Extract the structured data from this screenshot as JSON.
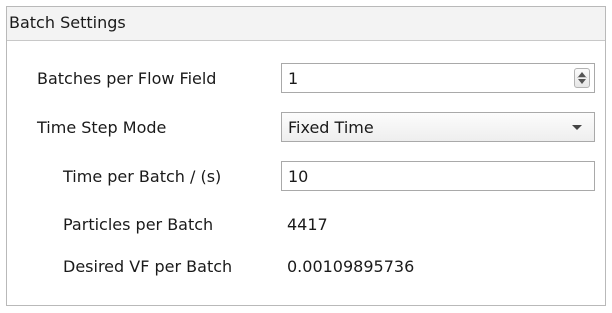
{
  "panel": {
    "title": "Batch Settings"
  },
  "fields": {
    "batches_per_flow_field": {
      "label": "Batches per Flow Field",
      "value": "1"
    },
    "time_step_mode": {
      "label": "Time Step Mode",
      "value": "Fixed Time"
    },
    "time_per_batch": {
      "label": "Time per Batch / (s)",
      "value": "10"
    },
    "particles_per_batch": {
      "label": "Particles per Batch",
      "value": "4417"
    },
    "desired_vf_per_batch": {
      "label": "Desired VF per Batch",
      "value": "0.00109895736"
    }
  },
  "icons": {
    "spinner": "spin-up-down-icon",
    "dropdown": "chevron-down-icon"
  }
}
